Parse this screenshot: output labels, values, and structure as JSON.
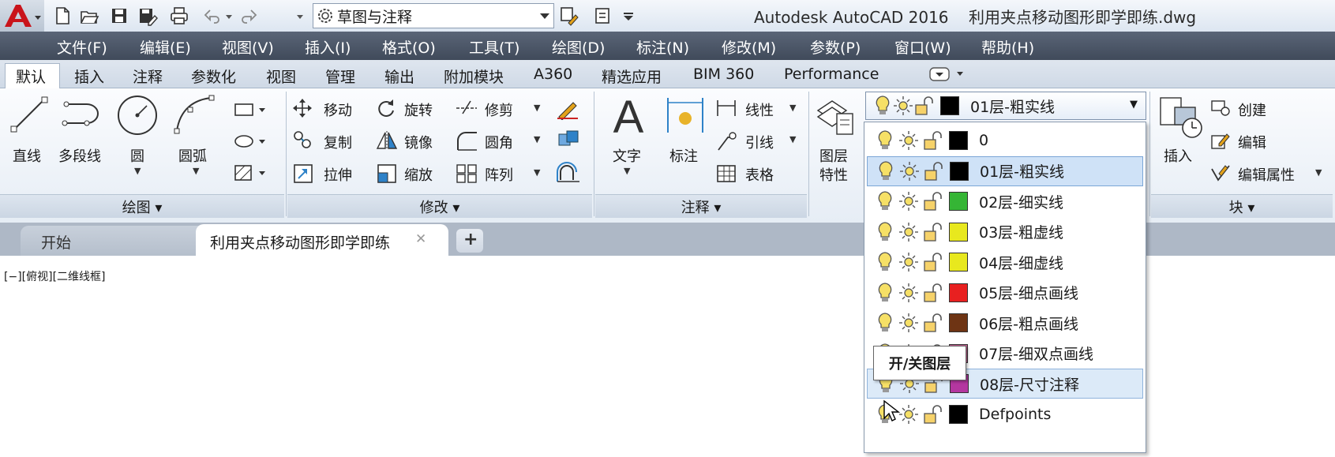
{
  "window": {
    "title": "Autodesk AutoCAD 2016    利用夹点移动图形即学即练.dwg"
  },
  "quick_access": {
    "workspace": "草图与注释"
  },
  "menu": [
    "文件(F)",
    "编辑(E)",
    "视图(V)",
    "插入(I)",
    "格式(O)",
    "工具(T)",
    "绘图(D)",
    "标注(N)",
    "修改(M)",
    "参数(P)",
    "窗口(W)",
    "帮助(H)"
  ],
  "ribbon_tabs": [
    "默认",
    "插入",
    "注释",
    "参数化",
    "视图",
    "管理",
    "输出",
    "附加模块",
    "A360",
    "精选应用",
    "BIM 360",
    "Performance"
  ],
  "ribbon_active_tab": "默认",
  "draw_panel": {
    "line": "直线",
    "polyline": "多段线",
    "circle": "圆",
    "arc": "圆弧",
    "footer": "绘图 ▾"
  },
  "modify_panel": {
    "move": "移动",
    "rotate": "旋转",
    "trim": "修剪",
    "copy": "复制",
    "mirror": "镜像",
    "fillet": "圆角",
    "stretch": "拉伸",
    "scale": "缩放",
    "array": "阵列",
    "footer": "修改 ▾"
  },
  "annotation_panel": {
    "text": "文字",
    "dimension": "标注",
    "linear": "线性",
    "leader": "引线",
    "table": "表格",
    "footer": "注释 ▾"
  },
  "layers_panel": {
    "properties_line1": "图层",
    "properties_line2": "特性",
    "current_layer": "01层-粗实线",
    "current_color": "#000000"
  },
  "block_panel": {
    "insert": "插入",
    "create": "创建",
    "edit": "编辑",
    "edit_attributes": "编辑属性",
    "footer": "块 ▾"
  },
  "file_tabs": {
    "start": "开始",
    "document": "利用夹点移动图形即学即练",
    "close_symbol": "✕",
    "add_symbol": "+"
  },
  "viewport": {
    "label": "[−][俯视][二维线框]"
  },
  "layer_list": [
    {
      "name": "0",
      "color": "#000000"
    },
    {
      "name": "01层-粗实线",
      "color": "#000000"
    },
    {
      "name": "02层-细实线",
      "color": "#35b535"
    },
    {
      "name": "03层-粗虚线",
      "color": "#e8e81e"
    },
    {
      "name": "04层-细虚线",
      "color": "#e8e81e"
    },
    {
      "name": "05层-细点画线",
      "color": "#e82020"
    },
    {
      "name": "06层-粗点画线",
      "color": "#6e3414"
    },
    {
      "name": "07层-细双点画线",
      "color": "#c05a8c"
    },
    {
      "name": "08层-尺寸注释",
      "color": "#b437a0"
    },
    {
      "name": "Defpoints",
      "color": "#000000"
    }
  ],
  "selected_layer_index": 1,
  "hovered_layer_index": 8,
  "tooltip": {
    "text": "开/关图层"
  }
}
